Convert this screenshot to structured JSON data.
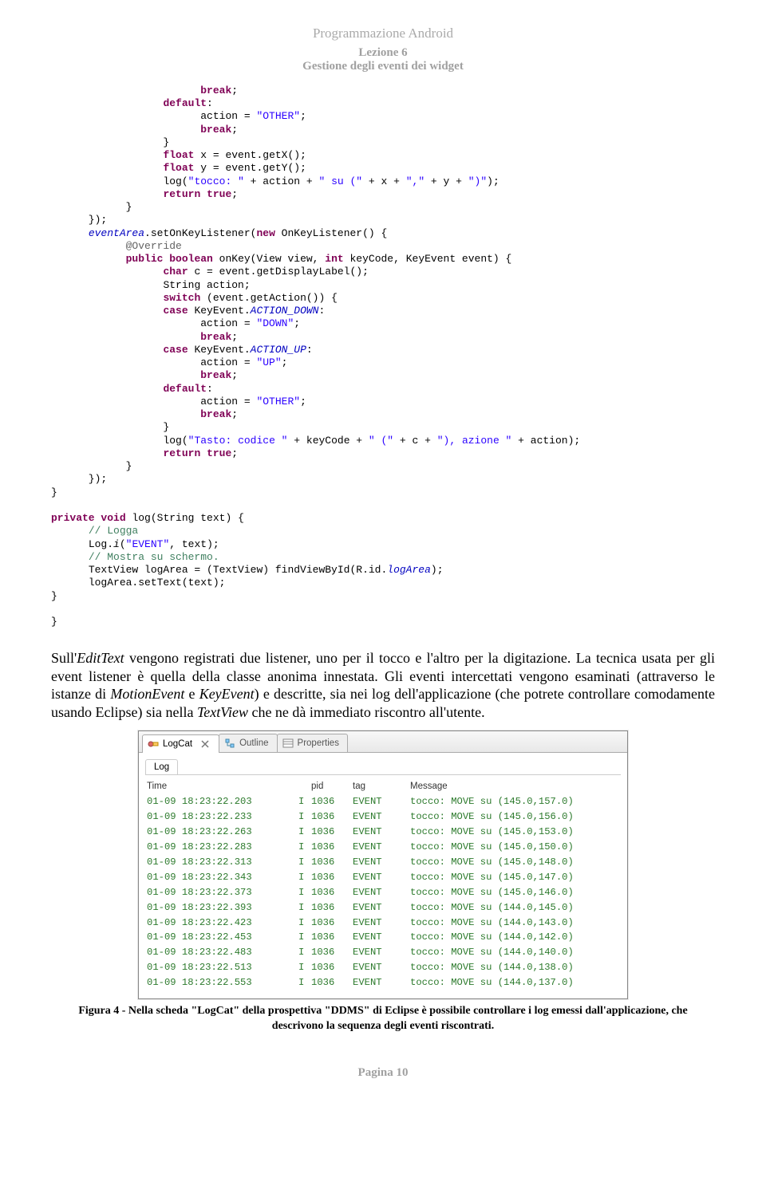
{
  "header": {
    "program": "Programmazione Android",
    "lesson": "Lezione 6",
    "subtitle": "Gestione degli eventi dei widget"
  },
  "code": {
    "l1a": "break",
    "l2a": "default",
    "l3a": "action = ",
    "l3b": "\"OTHER\"",
    "l4a": "break",
    "l6a": "float",
    "l6b": " x = event.getX();",
    "l7a": "float",
    "l7b": " y = event.getY();",
    "l8a": "log(",
    "l8b": "\"tocco: \"",
    "l8c": " + action + ",
    "l8d": "\" su (\"",
    "l8e": " + x + ",
    "l8f": "\",\"",
    "l8g": " + y + ",
    "l8h": "\")\"",
    "l8i": ");",
    "l9a": "return",
    "l9b": "true",
    "l11a": "eventArea",
    "l11b": ".setOnKeyListener(",
    "l11c": "new",
    "l11d": " OnKeyListener() {",
    "l12": "@Override",
    "l13a": "public",
    "l13b": "boolean",
    "l13c": " onKey(View view, ",
    "l13d": "int",
    "l13e": " keyCode, KeyEvent event) {",
    "l14a": "char",
    "l14b": " c = event.getDisplayLabel();",
    "l15": "String action;",
    "l16a": "switch",
    "l16b": " (event.getAction()) {",
    "l17a": "case",
    "l17b": " KeyEvent.",
    "l17c": "ACTION_DOWN",
    "l18a": "action = ",
    "l18b": "\"DOWN\"",
    "l19": "break",
    "l20a": "case",
    "l20b": " KeyEvent.",
    "l20c": "ACTION_UP",
    "l21a": "action = ",
    "l21b": "\"UP\"",
    "l22": "break",
    "l23": "default",
    "l24a": "action = ",
    "l24b": "\"OTHER\"",
    "l25": "break",
    "l27a": "log(",
    "l27b": "\"Tasto: codice \"",
    "l27c": " + keyCode + ",
    "l27d": "\" (\"",
    "l27e": " + c + ",
    "l27f": "\"), azione \"",
    "l27g": " + action);",
    "l28a": "return",
    "l28b": "true",
    "l32a": "private",
    "l32b": "void",
    "l32c": " log(String text) {",
    "l33": "// Logga",
    "l34a": "Log.",
    "l34b": "i",
    "l34c": "(",
    "l34d": "\"EVENT\"",
    "l34e": ", text);",
    "l35": "// Mostra su schermo.",
    "l36a": "TextView logArea = (TextView) findViewById(R.id.",
    "l36b": "logArea",
    "l36c": ");",
    "l37": "logArea.setText(text);"
  },
  "paragraph": {
    "p1": "Sull'",
    "p1i": "EditText",
    "p2": " vengono registrati due listener, uno per il tocco e l'altro per la digitazione. La tecnica usata per gli event listener è quella della classe anonima innestata. Gli eventi intercettati vengono esaminati (attraverso le istanze di ",
    "p2i": "MotionEvent",
    "p3": " e ",
    "p3i": "KeyEvent",
    "p4": ") e descritte, sia nei log dell'applicazione (che potrete controllare comodamente usando Eclipse) sia nella ",
    "p4i": "TextView",
    "p5": " che ne dà immediato riscontro all'utente."
  },
  "logcat": {
    "tabs": {
      "t1": "LogCat",
      "t2": "Outline",
      "t3": "Properties"
    },
    "subtab": "Log",
    "headers": {
      "time": "Time",
      "pid": "pid",
      "tag": "tag",
      "msg": "Message"
    },
    "rows": [
      {
        "time": "01-09 18:23:22.203",
        "i": "I",
        "pid": "1036",
        "tag": "EVENT",
        "msg": "tocco: MOVE su (145.0,157.0)"
      },
      {
        "time": "01-09 18:23:22.233",
        "i": "I",
        "pid": "1036",
        "tag": "EVENT",
        "msg": "tocco: MOVE su (145.0,156.0)"
      },
      {
        "time": "01-09 18:23:22.263",
        "i": "I",
        "pid": "1036",
        "tag": "EVENT",
        "msg": "tocco: MOVE su (145.0,153.0)"
      },
      {
        "time": "01-09 18:23:22.283",
        "i": "I",
        "pid": "1036",
        "tag": "EVENT",
        "msg": "tocco: MOVE su (145.0,150.0)"
      },
      {
        "time": "01-09 18:23:22.313",
        "i": "I",
        "pid": "1036",
        "tag": "EVENT",
        "msg": "tocco: MOVE su (145.0,148.0)"
      },
      {
        "time": "01-09 18:23:22.343",
        "i": "I",
        "pid": "1036",
        "tag": "EVENT",
        "msg": "tocco: MOVE su (145.0,147.0)"
      },
      {
        "time": "01-09 18:23:22.373",
        "i": "I",
        "pid": "1036",
        "tag": "EVENT",
        "msg": "tocco: MOVE su (145.0,146.0)"
      },
      {
        "time": "01-09 18:23:22.393",
        "i": "I",
        "pid": "1036",
        "tag": "EVENT",
        "msg": "tocco: MOVE su (144.0,145.0)"
      },
      {
        "time": "01-09 18:23:22.423",
        "i": "I",
        "pid": "1036",
        "tag": "EVENT",
        "msg": "tocco: MOVE su (144.0,143.0)"
      },
      {
        "time": "01-09 18:23:22.453",
        "i": "I",
        "pid": "1036",
        "tag": "EVENT",
        "msg": "tocco: MOVE su (144.0,142.0)"
      },
      {
        "time": "01-09 18:23:22.483",
        "i": "I",
        "pid": "1036",
        "tag": "EVENT",
        "msg": "tocco: MOVE su (144.0,140.0)"
      },
      {
        "time": "01-09 18:23:22.513",
        "i": "I",
        "pid": "1036",
        "tag": "EVENT",
        "msg": "tocco: MOVE su (144.0,138.0)"
      },
      {
        "time": "01-09 18:23:22.553",
        "i": "I",
        "pid": "1036",
        "tag": "EVENT",
        "msg": "tocco: MOVE su (144.0,137.0)"
      }
    ]
  },
  "caption": "Figura 4 - Nella scheda \"LogCat\" della prospettiva \"DDMS\" di Eclipse è possibile controllare i log emessi dall'applicazione, che descrivono la sequenza degli eventi riscontrati.",
  "footer": "Pagina 10"
}
